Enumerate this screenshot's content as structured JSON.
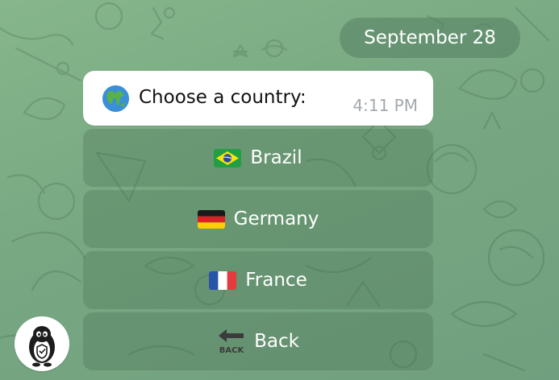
{
  "date_separator": "September 28",
  "message": {
    "emoji": "globe-icon",
    "text": "Choose a country:",
    "time": "4:11 PM"
  },
  "keyboard": {
    "buttons": [
      {
        "label": "Brazil",
        "icon": "brazil-flag-icon"
      },
      {
        "label": "Germany",
        "icon": "germany-flag-icon"
      },
      {
        "label": "France",
        "icon": "france-flag-icon"
      },
      {
        "label": "Back",
        "icon": "back-arrow-icon",
        "icon_text": "BACK"
      }
    ]
  },
  "colors": {
    "background": "#7fae86",
    "message_bg": "#ffffff",
    "time_text": "#a3a9ae",
    "button_text": "#ffffff"
  },
  "avatar": {
    "icon": "penguin-avatar-icon"
  }
}
